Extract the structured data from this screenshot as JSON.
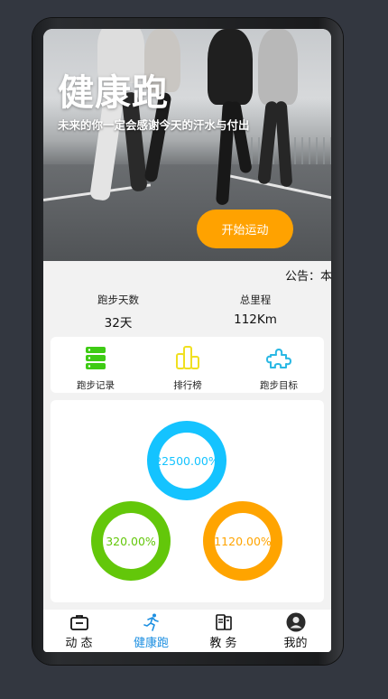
{
  "hero": {
    "title": "健康跑",
    "subtitle": "未来的你一定会感谢今天的汗水与付出",
    "start_button": "开始运动"
  },
  "notice": {
    "text": "公告：本"
  },
  "stats": [
    {
      "label": "跑步天数",
      "value": "32天"
    },
    {
      "label": "总里程",
      "value": "112Km"
    }
  ],
  "menu": [
    {
      "label": "跑步记录",
      "icon": "database-icon",
      "color": "#3ecb14"
    },
    {
      "label": "排行榜",
      "icon": "podium-icon",
      "color": "#f0e020"
    },
    {
      "label": "跑步目标",
      "icon": "puzzle-icon",
      "color": "#2ab8e4"
    }
  ],
  "rings": [
    {
      "value": "22500.00%",
      "color": "#14c3ff",
      "text_color": "#14c3ff",
      "progress": 225.0
    },
    {
      "value": "320.00%",
      "color": "#63c70a",
      "text_color": "#63c70a",
      "progress": 3.2
    },
    {
      "value": "1120.00%",
      "color": "#ffa400",
      "text_color": "#ffa400",
      "progress": 11.2
    }
  ],
  "tabs": [
    {
      "label": "动 态",
      "icon": "briefcase-icon",
      "active": false
    },
    {
      "label": "健康跑",
      "icon": "runner-icon",
      "active": true
    },
    {
      "label": "教 务",
      "icon": "book-icon",
      "active": false
    },
    {
      "label": "我的",
      "icon": "avatar-icon",
      "active": false
    }
  ],
  "colors": {
    "accent": "#ffa200",
    "tab_active": "#1d8fe1"
  }
}
